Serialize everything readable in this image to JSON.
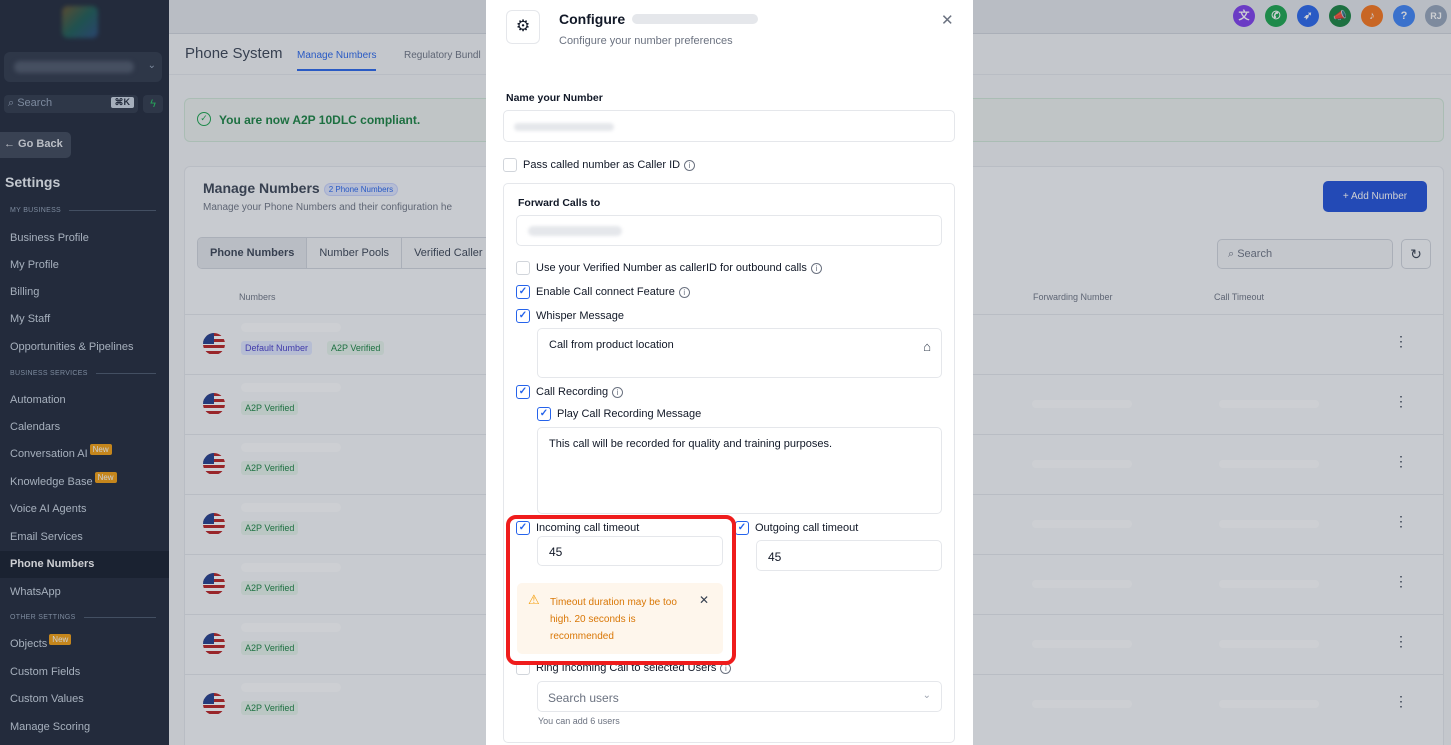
{
  "sidebar": {
    "search_placeholder": "Search",
    "search_shortcut": "⌘K",
    "go_back": "← Go Back",
    "settings_title": "Settings",
    "sections": {
      "my_business": "MY BUSINESS",
      "business_services": "BUSINESS SERVICES",
      "other_settings": "OTHER SETTINGS"
    },
    "items": [
      {
        "label": "Business Profile"
      },
      {
        "label": "My Profile"
      },
      {
        "label": "Billing"
      },
      {
        "label": "My Staff"
      },
      {
        "label": "Opportunities & Pipelines"
      },
      {
        "label": "Automation"
      },
      {
        "label": "Calendars"
      },
      {
        "label": "Conversation AI",
        "badge": "New"
      },
      {
        "label": "Knowledge Base",
        "badge": "New"
      },
      {
        "label": "Voice AI Agents"
      },
      {
        "label": "Email Services"
      },
      {
        "label": "Phone Numbers"
      },
      {
        "label": "WhatsApp"
      },
      {
        "label": "Objects",
        "badge": "New"
      },
      {
        "label": "Custom Fields"
      },
      {
        "label": "Custom Values"
      },
      {
        "label": "Manage Scoring"
      }
    ]
  },
  "topbar": {
    "avatar_initials": "RJ",
    "help": "?"
  },
  "page": {
    "title": "Phone System",
    "tabs": [
      "Manage Numbers",
      "Regulatory Bundl"
    ],
    "compliance_message": "You are now A2P 10DLC compliant."
  },
  "card": {
    "title": "Manage Numbers",
    "count_badge": "2 Phone Numbers",
    "subtitle": "Manage your Phone Numbers and their configuration he",
    "add_button": "+  Add Number",
    "segments": [
      "Phone Numbers",
      "Number Pools",
      "Verified Caller"
    ],
    "search_placeholder": "Search",
    "columns": {
      "numbers": "Numbers",
      "forwarding": "Forwarding Number",
      "timeout": "Call Timeout"
    },
    "rows": [
      {
        "tags": [
          "Default Number",
          "A2P Verified"
        ]
      },
      {
        "tags": [
          "A2P Verified"
        ]
      },
      {
        "tags": [
          "A2P Verified"
        ]
      },
      {
        "tags": [
          "A2P Verified"
        ]
      },
      {
        "tags": [
          "A2P Verified"
        ]
      },
      {
        "tags": [
          "A2P Verified"
        ]
      },
      {
        "tags": [
          "A2P Verified"
        ]
      }
    ]
  },
  "modal": {
    "title": "Configure",
    "subtitle": "Configure your number preferences",
    "name_label": "Name your Number",
    "pass_caller_id": "Pass called number as Caller ID",
    "forward_label": "Forward Calls to",
    "use_verified": "Use your Verified Number as callerID for outbound calls",
    "call_connect": "Enable Call connect Feature",
    "whisper": "Whisper Message",
    "whisper_text": "Call from product location",
    "call_recording": "Call Recording",
    "play_recording": "Play Call Recording Message",
    "recording_text": "This call will be recorded for quality and training purposes.",
    "incoming_timeout_label": "Incoming call timeout",
    "incoming_timeout_value": "45",
    "outgoing_timeout_label": "Outgoing call timeout",
    "outgoing_timeout_value": "45",
    "warning": "Timeout duration may be too high. 20 seconds is recommended",
    "ring_users": "Ring Incoming Call to selected Users",
    "search_users_placeholder": "Search users",
    "users_hint": "You can add 6 users"
  },
  "colors": {
    "accent": "#2563eb",
    "highlight_ring": "#ef1c1c",
    "warning": "#d97706",
    "sidebar_bg": "#1c2536"
  }
}
